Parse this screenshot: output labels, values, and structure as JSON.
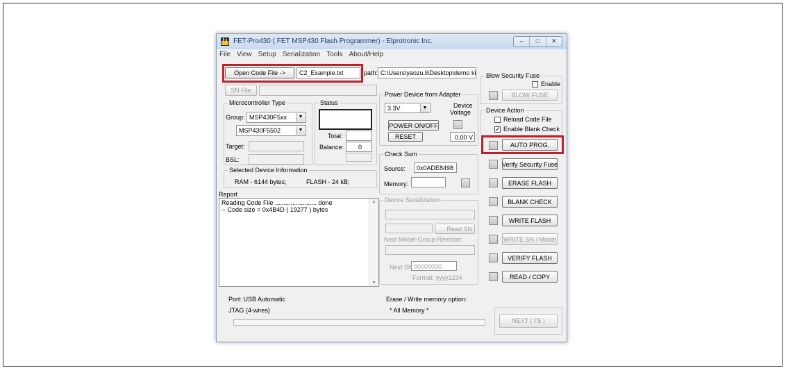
{
  "window": {
    "title": "FET-Pro430  ( FET MSP430 Flash Programmer)  -  Elprotronic Inc.",
    "controls": [
      "–",
      "□",
      "✕"
    ]
  },
  "menu": [
    "File",
    "View",
    "Setup",
    "Serialization",
    "Tools",
    "About/Help"
  ],
  "code_file": {
    "open_button": "Open Code File     ->",
    "file_name": "C2_Example.txt",
    "path_label": "path:",
    "path_value": "C:\\Users\\yaozu.li\\Desktop\\demo kit"
  },
  "sn_file": {
    "button": "SN File",
    "value": ""
  },
  "microcontroller": {
    "legend": "Microcontroller Type",
    "group_label": "Group:",
    "group_value": "MSP430F5xx",
    "device_value": "MSP430F5502",
    "target_label": "Target:",
    "bsl_label": "BSL:"
  },
  "status": {
    "legend": "Status",
    "total_label": "Total:",
    "total_value": "",
    "balance_label": "Balance:",
    "balance_value": "0"
  },
  "selected_device": {
    "legend": "Selected Device Information",
    "ram": "RAM -  6144 bytes;",
    "flash": "FLASH - 24 kB;"
  },
  "report": {
    "label": "Report",
    "lines": [
      "Reading Code File  ........................        done",
      "-- Code size = 0x4B4D ( 19277 ) bytes"
    ]
  },
  "power": {
    "legend": "Power Device from Adapter",
    "voltage": "3.3V",
    "device_voltage_label": "Device\nVoltage",
    "device_voltage_l1": "Device",
    "device_voltage_l2": "Voltage",
    "power_button": "POWER ON/OFF",
    "reset_button": "RESET",
    "voltage_readout": "0.00 V"
  },
  "checksum": {
    "legend": "Check Sum",
    "source_label": "Source:",
    "source_value": "0x0ADE8498",
    "memory_label": "Memory:",
    "memory_value": ""
  },
  "serialization": {
    "legend": "Device Serialization",
    "read_sn": "Read SN",
    "next_model_label": "Next Model-Group-Revision:",
    "next_sn_label": "Next SN:",
    "next_sn_value": "00000000",
    "format": "Format: yyyy1234"
  },
  "blow_fuse": {
    "legend": "Blow Security Fuse",
    "enable": "Enable",
    "button": "BLOW FUSE"
  },
  "device_action": {
    "legend": "Device Action",
    "reload": "Reload Code File",
    "reload_checked": false,
    "blank_check": "Enable Blank Check",
    "blank_check_checked": true,
    "auto_prog": "AUTO PROG."
  },
  "actions": [
    "Verify Security Fuse",
    "ERASE FLASH",
    "BLANK CHECK",
    "WRITE FLASH",
    "WRITE SN / Model",
    "VERIFY FLASH",
    "READ / COPY"
  ],
  "footer": {
    "port": "Port: USB Automatic",
    "jtag": "JTAG (4-wires)",
    "erase_option_label": "Erase / Write memory option:",
    "erase_option_value": "* All Memory *",
    "next_button": "NEXT  ( F5 )"
  },
  "colors": {
    "highlight": "#c0202c",
    "title_text": "#1e395b"
  }
}
